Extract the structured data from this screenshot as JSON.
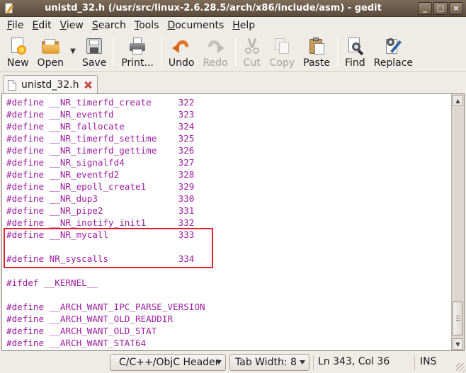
{
  "window": {
    "title": "unistd_32.h (/usr/src/linux-2.6.28.5/arch/x86/include/asm) - gedit",
    "controls": [
      "_",
      "□",
      "×"
    ]
  },
  "menu": {
    "items": [
      {
        "label": "File",
        "accel": "F",
        "rest": "ile"
      },
      {
        "label": "Edit",
        "accel": "E",
        "rest": "dit"
      },
      {
        "label": "View",
        "accel": "V",
        "rest": "iew"
      },
      {
        "label": "Search",
        "accel": "S",
        "rest": "earch"
      },
      {
        "label": "Tools",
        "accel": "T",
        "rest": "ools"
      },
      {
        "label": "Documents",
        "accel": "D",
        "rest": "ocuments"
      },
      {
        "label": "Help",
        "accel": "H",
        "rest": "elp"
      }
    ]
  },
  "toolbar": {
    "new_label": "New",
    "open_label": "Open",
    "save_label": "Save",
    "print_label": "Print...",
    "undo_label": "Undo",
    "redo_label": "Redo",
    "cut_label": "Cut",
    "copy_label": "Copy",
    "paste_label": "Paste",
    "find_label": "Find",
    "replace_label": "Replace",
    "disabled": [
      "Redo",
      "Cut",
      "Copy"
    ]
  },
  "tabs": [
    {
      "label": "unistd_32.h",
      "active": true
    }
  ],
  "editor": {
    "text_color": "#9d1ca1",
    "lines": [
      "#define __NR_timerfd_create     322",
      "#define __NR_eventfd            323",
      "#define __NR_fallocate          324",
      "#define __NR_timerfd_settime    325",
      "#define __NR_timerfd_gettime    326",
      "#define __NR_signalfd4          327",
      "#define __NR_eventfd2           328",
      "#define __NR_epoll_create1      329",
      "#define __NR_dup3               330",
      "#define __NR_pipe2              331",
      "#define __NR_inotify_init1      332",
      "#define __NR_mycall             333",
      "",
      "#define NR_syscalls             334",
      "",
      "#ifdef __KERNEL__",
      "",
      "#define __ARCH_WANT_IPC_PARSE_VERSION",
      "#define __ARCH_WANT_OLD_READDIR",
      "#define __ARCH_WANT_OLD_STAT",
      "#define __ARCH_WANT_STAT64"
    ],
    "highlight_color": "#d9242f"
  },
  "statusbar": {
    "language": "C/C++/ObjC Header",
    "tab_width": "Tab Width: 8",
    "position": "Ln 343, Col 36",
    "mode": "INS"
  }
}
